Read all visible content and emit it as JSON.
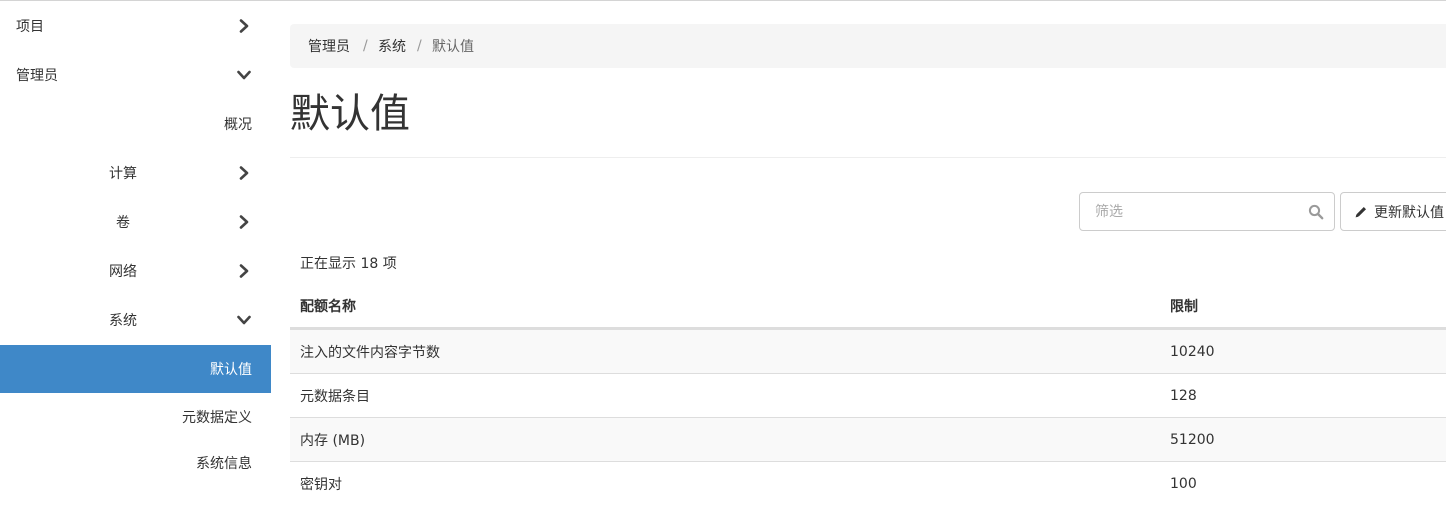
{
  "sidebar": {
    "items": [
      {
        "label": "项目",
        "chevron": "right"
      },
      {
        "label": "管理员",
        "chevron": "down"
      },
      {
        "label": "概况"
      },
      {
        "label": "计算",
        "chevron": "right"
      },
      {
        "label": "卷",
        "chevron": "right"
      },
      {
        "label": "网络",
        "chevron": "right"
      },
      {
        "label": "系统",
        "chevron": "down"
      },
      {
        "label": "默认值",
        "active": true
      },
      {
        "label": "元数据定义"
      },
      {
        "label": "系统信息"
      }
    ]
  },
  "breadcrumb": {
    "items": [
      "管理员",
      "系统",
      "默认值"
    ],
    "separator": "/"
  },
  "page": {
    "title": "默认值"
  },
  "toolbar": {
    "filter_placeholder": "筛选",
    "update_label": "更新默认值",
    "search_icon": "search-icon",
    "pencil_icon": "pencil-icon"
  },
  "table": {
    "count_text": "正在显示 18 项",
    "headers": [
      "配额名称",
      "限制"
    ],
    "rows": [
      {
        "name": "注入的文件内容字节数",
        "limit": "10240"
      },
      {
        "name": "元数据条目",
        "limit": "128"
      },
      {
        "name": "内存 (MB)",
        "limit": "51200"
      },
      {
        "name": "密钥对",
        "limit": "100"
      }
    ]
  },
  "colors": {
    "active_bg": "#3f88c8",
    "breadcrumb_bg": "#f5f5f5",
    "striped_row": "#f9f9f9"
  }
}
